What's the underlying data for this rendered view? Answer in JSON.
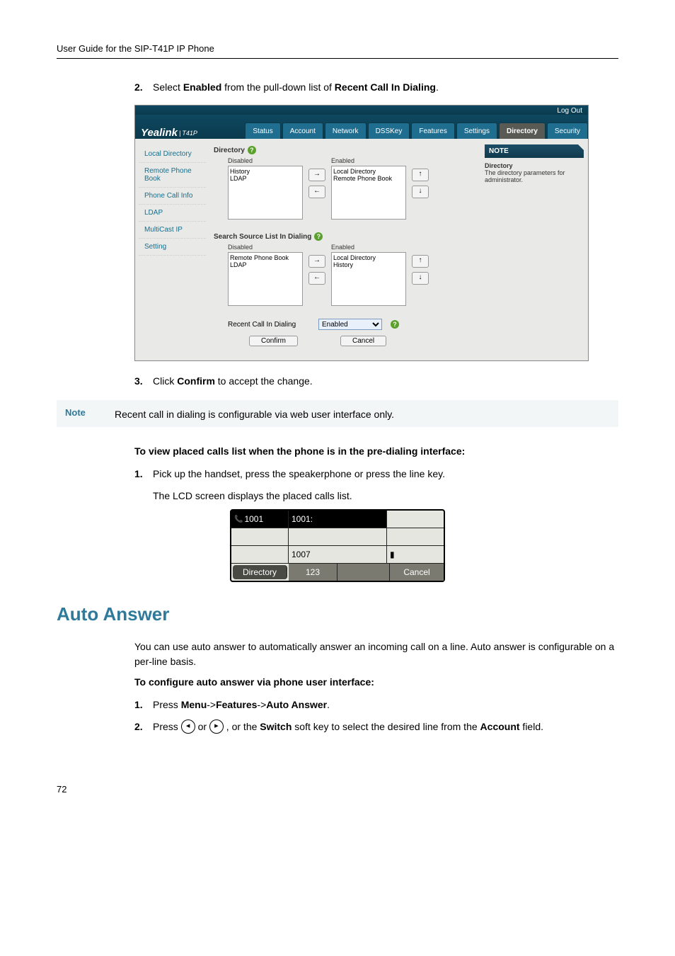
{
  "header": {
    "title": "User Guide for the SIP-T41P IP Phone"
  },
  "step2": {
    "num": "2.",
    "pre": "Select ",
    "b1": "Enabled",
    "mid": " from the pull-down list of ",
    "b2": "Recent Call In Dialing",
    "post": "."
  },
  "screenshot": {
    "logo": "Yealink",
    "logo_sub": "T41P",
    "logout": "Log Out",
    "tabs": [
      "Status",
      "Account",
      "Network",
      "DSSKey",
      "Features",
      "Settings",
      "Directory",
      "Security"
    ],
    "active_tab": "Directory",
    "sidebar": [
      "Local Directory",
      "Remote Phone Book",
      "Phone Call Info",
      "LDAP",
      "MultiCast IP",
      "Setting"
    ],
    "section1_title": "Directory",
    "list1_disabled_title": "Disabled",
    "list1_disabled_items": "History\nLDAP",
    "list1_enabled_title": "Enabled",
    "list1_enabled_items": "Local Directory\nRemote Phone Book",
    "section2_title": "Search Source List In Dialing",
    "list2_disabled_title": "Disabled",
    "list2_disabled_items": "Remote Phone Book\nLDAP",
    "list2_enabled_title": "Enabled",
    "list2_enabled_items": "Local Directory\nHistory",
    "recent_label": "Recent Call In Dialing",
    "recent_value": "Enabled",
    "confirm": "Confirm",
    "cancel": "Cancel",
    "note_head": "NOTE",
    "note_title": "Directory",
    "note_body": "The directory parameters for administrator.",
    "arrow_r": "→",
    "arrow_l": "←",
    "arrow_u": "↑",
    "arrow_d": "↓"
  },
  "step3": {
    "num": "3.",
    "pre": "Click ",
    "b1": "Confirm",
    "post": " to accept the change."
  },
  "note": {
    "label": "Note",
    "text": "Recent call in dialing is configurable via web user interface only."
  },
  "view_heading": "To view placed calls list when the phone is in the pre-dialing interface:",
  "step_v1": {
    "num": "1.",
    "text": "Pick up the handset, press the speakerphone or press the line key."
  },
  "lcd_line": "The LCD screen displays the placed calls list.",
  "lcd": {
    "r1c1": "1001",
    "r1c2": "1001:",
    "r3c1": "1007",
    "r4c1": "Directory",
    "r4c2": "123",
    "r4c4": "Cancel"
  },
  "auto_answer": {
    "title": "Auto Answer",
    "para": "You can use auto answer to automatically answer an incoming call on a line. Auto answer is configurable on a per-line basis.",
    "sub": "To configure auto answer via phone user interface:",
    "s1_num": "1.",
    "s1_pre": "Press ",
    "s1_b1": "Menu",
    "s1_a1": "->",
    "s1_b2": "Features",
    "s1_a2": "->",
    "s1_b3": "Auto Answer",
    "s1_post": ".",
    "s2_num": "2.",
    "s2_pre": "Press ",
    "s2_left": "◂",
    "s2_or": " or ",
    "s2_right": "▸",
    "s2_mid": " , or the ",
    "s2_b1": "Switch",
    "s2_mid2": " soft key to select the desired line from the ",
    "s2_b2": "Account",
    "s2_post": " field."
  },
  "page_number": "72"
}
